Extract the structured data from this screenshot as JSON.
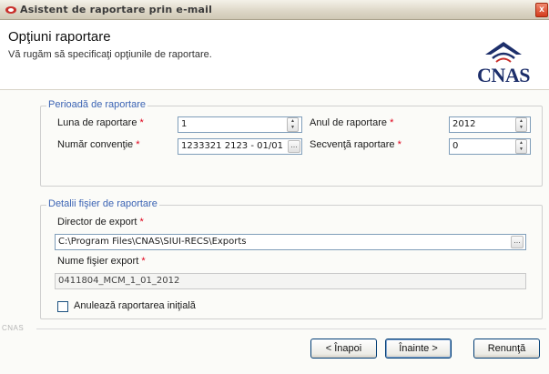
{
  "window": {
    "title": "Asistent de raportare prin e-mail",
    "close_glyph": "x"
  },
  "header": {
    "title": "Opţiuni raportare",
    "subtitle": "Vă rugăm să specificaţi opţiunile de raportare.",
    "logo_text": "CNAS"
  },
  "period": {
    "legend": "Perioadă de raportare",
    "month_label": "Luna de raportare",
    "month_value": "1",
    "year_label": "Anul de raportare",
    "year_value": "2012",
    "convention_label": "Număr convenţie",
    "convention_value": "1233321 2123 - 01/01",
    "sequence_label": "Secvenţă raportare",
    "sequence_value": "0",
    "required_mark": "*"
  },
  "file": {
    "legend": "Detalii fişier de raportare",
    "dir_label": "Director de export",
    "dir_value": "C:\\Program Files\\CNAS\\SIUI-RECS\\Exports",
    "name_label": "Nume fişier export",
    "name_value": "0411804_MCM_1_01_2012",
    "cancel_initial_label": "Anulează raportarea iniţială",
    "required_mark": "*"
  },
  "footer": {
    "tag": "CNAS",
    "back_label": "< Înapoi",
    "next_label": "Înainte >",
    "cancel_label": "Renunţă"
  },
  "colors": {
    "legend": "#3c64b4",
    "required": "#e0001a",
    "logo": "#1d2f6b"
  }
}
